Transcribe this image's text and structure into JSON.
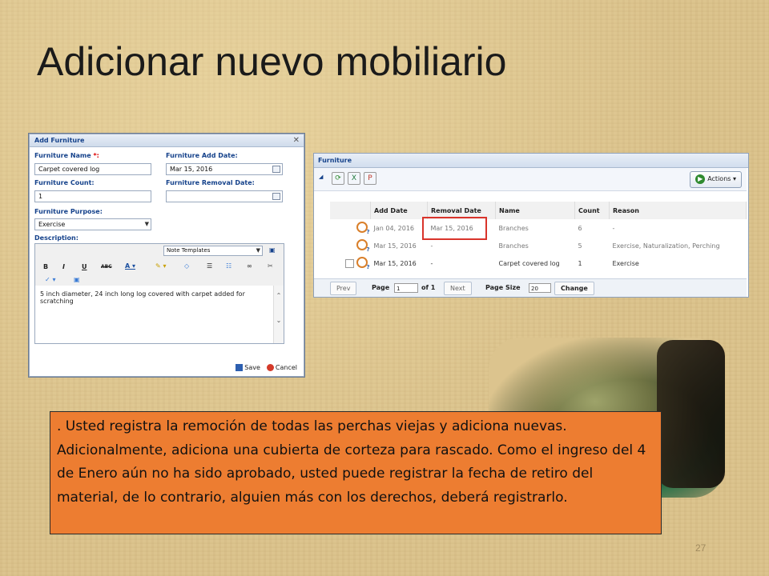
{
  "slide": {
    "title": "Adicionar nuevo mobiliario",
    "page_number": "27",
    "caption": ". Usted registra la remoción de todas las perchas viejas y adiciona nuevas. Adicionalmente, adiciona una cubierta de corteza para rascado.  Como el ingreso del 4 de Enero aún no ha sido aprobado, usted puede registrar la fecha de retiro del material, de lo contrario, alguien más con los derechos, deberá registrarlo."
  },
  "add_dialog": {
    "title": "Add Furniture",
    "name_label": "Furniture Name",
    "required_mark": "*:",
    "name_value": "Carpet covered log",
    "add_date_label": "Furniture Add Date:",
    "add_date_value": "Mar 15, 2016",
    "count_label": "Furniture Count:",
    "count_value": "1",
    "removal_date_label": "Furniture Removal Date:",
    "removal_date_value": "",
    "purpose_label": "Furniture Purpose:",
    "purpose_value": "Exercise",
    "description_label": "Description:",
    "note_templates": "Note Templates",
    "toolbar": {
      "bold": "B",
      "italic": "I",
      "underline": "U",
      "strike": "ABC"
    },
    "description_value": "5 inch diameter, 24 inch long log covered with carpet added for scratching",
    "save_label": "Save",
    "cancel_label": "Cancel"
  },
  "grid": {
    "title": "Furniture",
    "actions_label": "Actions",
    "columns": [
      "Add Date",
      "Removal Date",
      "Name",
      "Count",
      "Reason"
    ],
    "rows": [
      {
        "add_date": "Jan 04, 2016",
        "removal_date": "Mar 15, 2016",
        "name": "Branches",
        "count": "6",
        "reason": "-"
      },
      {
        "add_date": "Mar 15, 2016",
        "removal_date": "-",
        "name": "Branches",
        "count": "5",
        "reason": "Exercise, Naturalization, Perching"
      },
      {
        "add_date": "Mar 15, 2016",
        "removal_date": "-",
        "name": "Carpet covered log",
        "count": "1",
        "reason": "Exercise"
      }
    ],
    "pager": {
      "prev": "Prev",
      "page_label": "Page",
      "page_value": "1",
      "of_label": "of 1",
      "next": "Next",
      "page_size_label": "Page Size",
      "page_size_value": "20",
      "change": "Change"
    }
  },
  "colors": {
    "caption_bg": "#ed7d31",
    "highlight": "#d9342b",
    "ext_blue": "#15428b"
  }
}
